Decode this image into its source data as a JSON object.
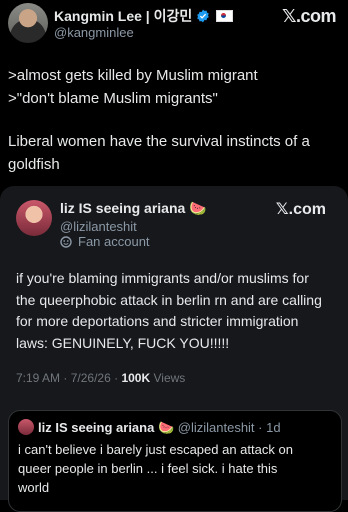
{
  "outer_tweet": {
    "author_name": "Kangmin Lee | 이강민",
    "handle": "@kangminlee",
    "brand": "𝕏.com",
    "body_lines": [
      ">almost gets killed by Muslim migrant",
      ">\"don't blame Muslim migrants\"",
      "Liberal women have the survival instincts of a",
      "goldfish"
    ]
  },
  "quoted_tweet": {
    "author_name": "liz IS seeing ariana 🍉",
    "handle": "@lizilanteshit",
    "account_label": "Fan account",
    "brand": "𝕏.com",
    "body_lines": [
      "if you're blaming immigrants and/or muslims for",
      "the queerphobic attack in berlin rn and are calling",
      "for more deportations and stricter immigration",
      "laws: GENUINELY, FUCK YOU!!!!!"
    ],
    "time": "7:19 AM",
    "date": "7/26/26",
    "separator": "·",
    "views_count": "100K",
    "views_label": "Views"
  },
  "nested_quote": {
    "author_name": "liz IS seeing ariana 🍉",
    "handle": "@lizilanteshit",
    "age": "· 1d",
    "body_lines": [
      "i can't believe i barely just escaped an attack on",
      "queer people in berlin ... i feel sick. i hate this",
      "world"
    ]
  }
}
